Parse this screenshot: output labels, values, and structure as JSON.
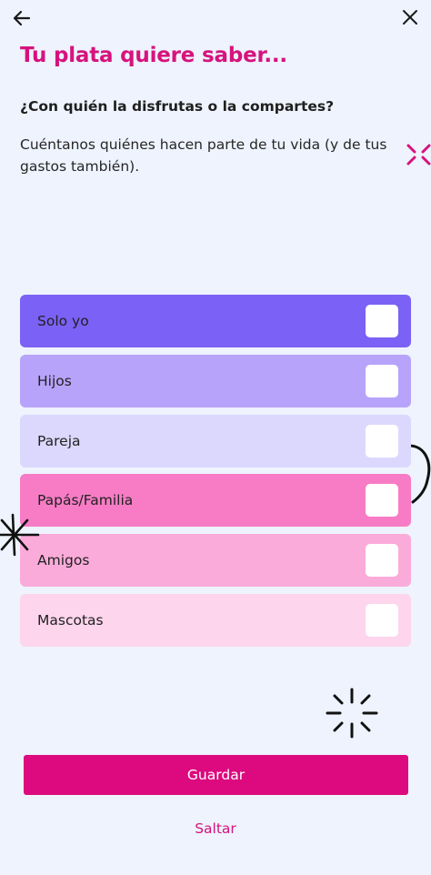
{
  "header": {
    "back_icon": "arrow-left-icon",
    "close_icon": "close-icon",
    "title": "Tu plata quiere saber..."
  },
  "question": "¿Con quién la disfrutas o la compartes?",
  "description": "Cuéntanos quiénes hacen parte de tu vida (y de tus gastos también).",
  "options": [
    {
      "label": "Solo yo",
      "color": "#7b61f5",
      "checked": false
    },
    {
      "label": "Hijos",
      "color": "#b7a3fa",
      "checked": false
    },
    {
      "label": "Pareja",
      "color": "#dcd8fd",
      "checked": false
    },
    {
      "label": "Papás/Familia",
      "color": "#f77cc5",
      "checked": false
    },
    {
      "label": "Amigos",
      "color": "#fbabd9",
      "checked": false
    },
    {
      "label": "Mascotas",
      "color": "#fdd5ed",
      "checked": false
    }
  ],
  "actions": {
    "save_label": "Guardar",
    "skip_label": "Saltar"
  },
  "colors": {
    "accent": "#d6137d",
    "button": "#dc0a7e",
    "background": "#eef3fd"
  }
}
